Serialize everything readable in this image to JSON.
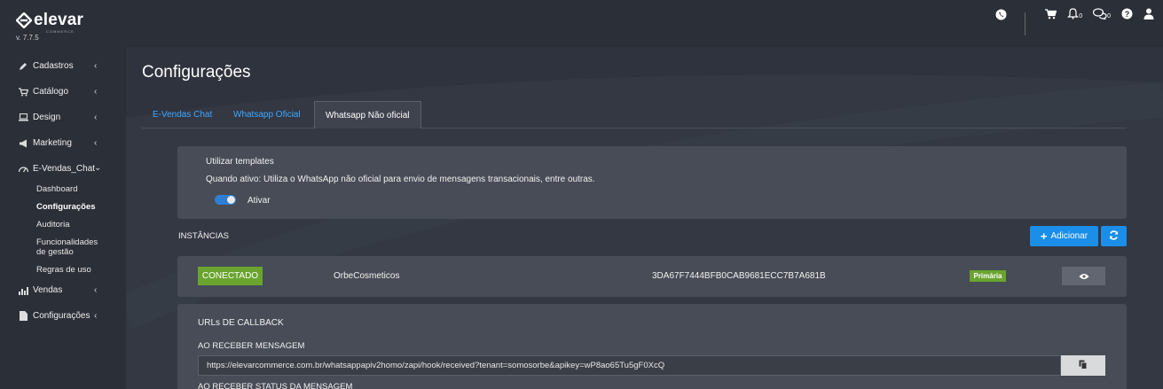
{
  "brand": {
    "name": "elevar",
    "subtitle": "COMMERCE",
    "version": "v. 7.7.5"
  },
  "sidebar": {
    "items": [
      {
        "label": "Cadastros",
        "icon": "pencil-icon"
      },
      {
        "label": "Catálogo",
        "icon": "cart-icon"
      },
      {
        "label": "Design",
        "icon": "laptop-icon"
      },
      {
        "label": "Marketing",
        "icon": "megaphone-icon"
      },
      {
        "label": "E-Vendas_Chat",
        "icon": "dashboard-icon"
      },
      {
        "label": "Vendas",
        "icon": "bar-chart-icon"
      },
      {
        "label": "Configurações",
        "icon": "document-icon"
      }
    ],
    "submenu": [
      "Dashboard",
      "Configurações",
      "Auditoria",
      "Funcionalidades de gestão",
      "Regras de uso"
    ],
    "submenu_active": "Configurações"
  },
  "topbar": {
    "notif_count": "0",
    "messages_count": "0"
  },
  "page": {
    "title": "Configurações"
  },
  "tabs": [
    "E-Vendas Chat",
    "Whatsapp Oficial",
    "Whatsapp Não oficial"
  ],
  "templates": {
    "heading": "Utilizar templates",
    "description": "Quando ativo: Utiliza o WhatsApp não oficial para envio de mensagens transacionais, entre outras.",
    "toggle_label": "Ativar",
    "toggle_on": true
  },
  "instances": {
    "title": "INSTÂNCIAS",
    "add_label": "Adicionar",
    "rows": [
      {
        "status": "CONECTADO",
        "name": "OrbeCosmeticos",
        "id": "3DA67F7444BFB0CAB9681ECC7B7A681B",
        "badge": "Primária"
      }
    ]
  },
  "callbacks": {
    "title": "URLs DE CALLBACK",
    "received_label": "AO RECEBER MENSAGEM",
    "received_url": "https://elevarcommerce.com.br/whatsappapiv2homo/zapi/hook/received?tenant=somosorbe&apikey=wP8ao65Tu5gF0XcQ",
    "status_label": "AO RECEBER STATUS DA MENSAGEM"
  },
  "colors": {
    "accent": "#1a8ee8",
    "success": "#6aa42f",
    "link": "#3fa8ff"
  }
}
